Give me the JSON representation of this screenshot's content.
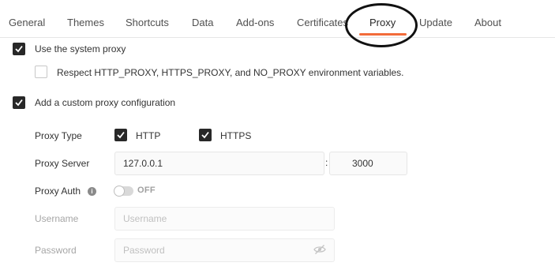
{
  "tabs": [
    {
      "label": "General"
    },
    {
      "label": "Themes"
    },
    {
      "label": "Shortcuts"
    },
    {
      "label": "Data"
    },
    {
      "label": "Add-ons"
    },
    {
      "label": "Certificates"
    },
    {
      "label": "Proxy",
      "active": true
    },
    {
      "label": "Update"
    },
    {
      "label": "About"
    }
  ],
  "system_proxy": {
    "label": "Use the system proxy",
    "checked": true,
    "respect_env": {
      "label": "Respect HTTP_PROXY, HTTPS_PROXY, and NO_PROXY environment variables.",
      "checked": false
    }
  },
  "custom_proxy": {
    "label": "Add a custom proxy configuration",
    "checked": true,
    "proxy_type": {
      "label": "Proxy Type",
      "options": [
        {
          "label": "HTTP",
          "checked": true
        },
        {
          "label": "HTTPS",
          "checked": true
        }
      ]
    },
    "proxy_server": {
      "label": "Proxy Server",
      "host": "127.0.0.1",
      "separator": ":",
      "port": "3000"
    },
    "proxy_auth": {
      "label": "Proxy Auth",
      "info_icon": "info-icon",
      "toggle_state": "OFF"
    },
    "username": {
      "label": "Username",
      "placeholder": "Username"
    },
    "password": {
      "label": "Password",
      "placeholder": "Password",
      "visibility_icon": "eye-slash-icon"
    }
  },
  "colors": {
    "accent": "#f26b3a",
    "checkbox": "#282828"
  }
}
